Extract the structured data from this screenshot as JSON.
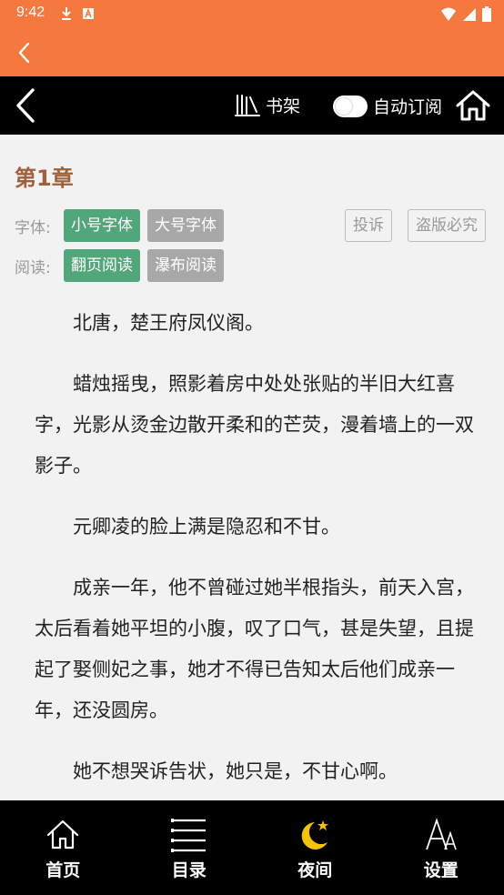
{
  "status_bar": {
    "time": "9:42",
    "icons": [
      "download-icon",
      "a-badge-icon",
      "wifi-icon",
      "signal-icon",
      "battery-icon"
    ]
  },
  "app_bar": {
    "back_icon": "chevron-left-icon",
    "color": "#f5793f"
  },
  "reader_bar": {
    "shelf_label": "书架",
    "auto_subscribe_label": "自动订阅",
    "auto_subscribe_on": false,
    "home_icon": "home-icon"
  },
  "chapter": {
    "title": "第1章"
  },
  "font_options": {
    "label": "字体:",
    "small": "小号字体",
    "large": "大号字体",
    "selected": "小号字体"
  },
  "read_options": {
    "label": "阅读:",
    "page_flip": "翻页阅读",
    "waterfall": "瀑布阅读",
    "selected": "翻页阅读"
  },
  "actions": {
    "complain": "投诉",
    "piracy": "盗版必究"
  },
  "paragraphs": [
    "北唐，楚王府凤仪阁。",
    "蜡烛摇曳，照影着房中处处张贴的半旧大红喜字，光影从烫金边散开柔和的芒荧，漫着墙上的一双影子。",
    "元卿凌的脸上满是隐忍和不甘。",
    "成亲一年，他不曾碰过她半根指头，前天入宫，太后看着她平坦的小腹，叹了口气，甚是失望，且提起了娶侧妃之事，她才不得已告知太后他们成亲一年，还没圆房。",
    "她不想哭诉告状，她只是，不甘心啊。"
  ],
  "bottom_nav": [
    {
      "label": "首页",
      "icon": "home-icon"
    },
    {
      "label": "目录",
      "icon": "catalog-list-icon"
    },
    {
      "label": "夜间",
      "icon": "moon-star-icon"
    },
    {
      "label": "设置",
      "icon": "font-settings-icon"
    }
  ],
  "colors": {
    "accent": "#f5793f",
    "chip_active": "#51a779",
    "chip_inactive": "#a8a8a8",
    "title": "#a0603a",
    "moon": "#f5c400"
  }
}
